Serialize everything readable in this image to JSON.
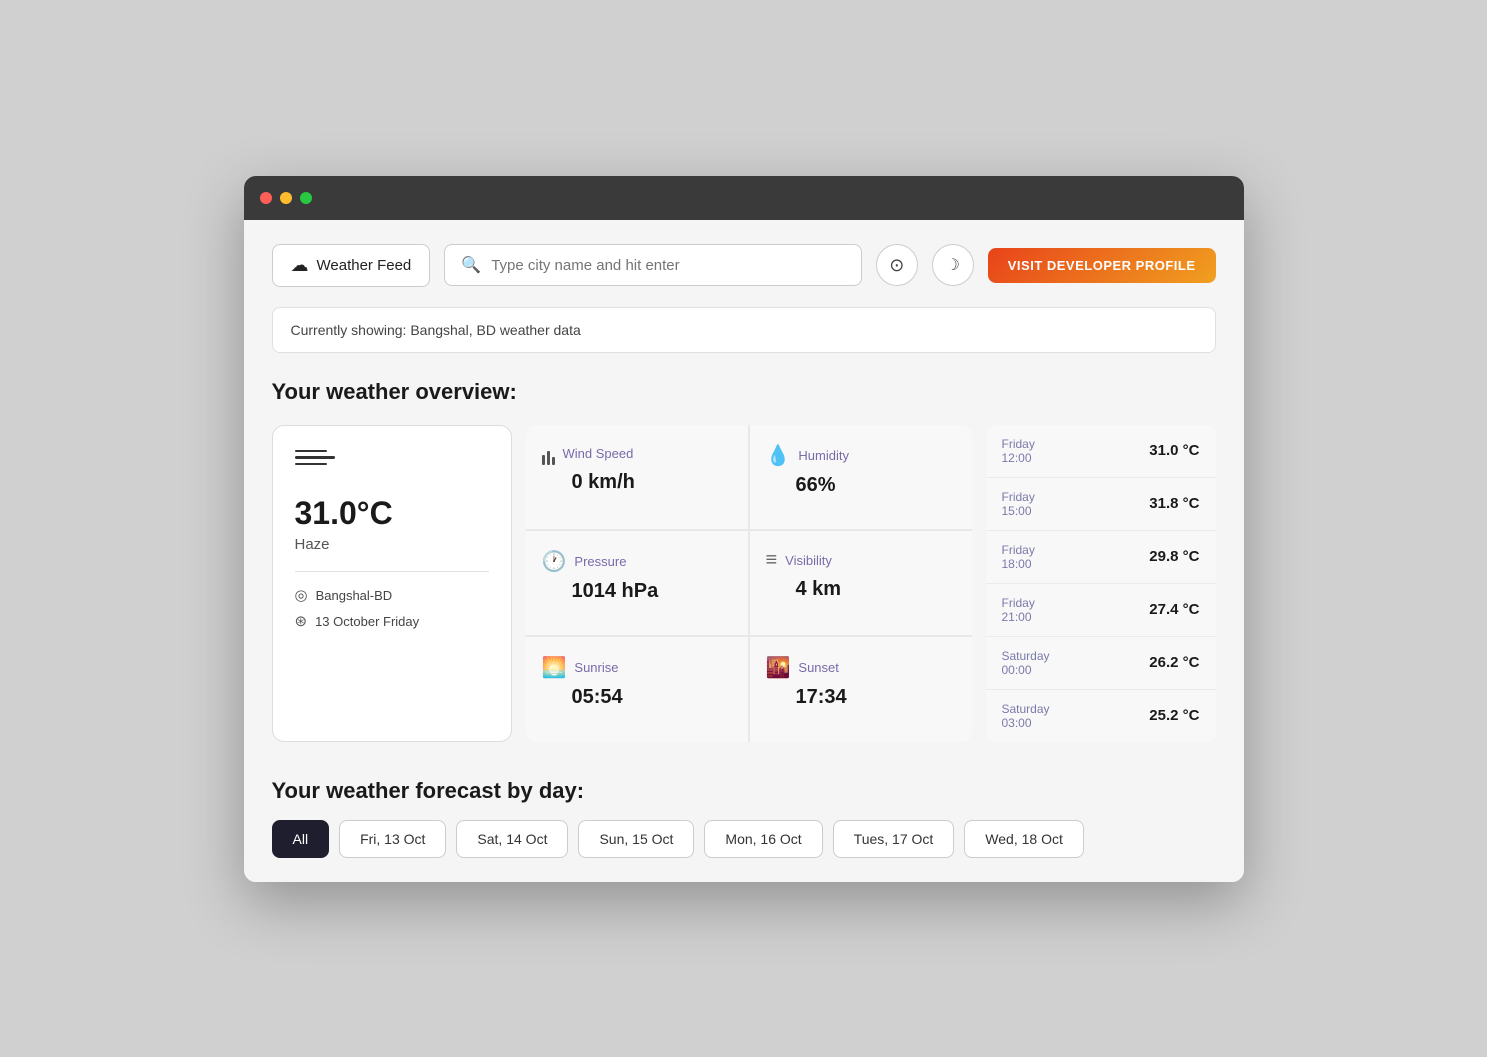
{
  "titlebar": {
    "dots": [
      "red",
      "yellow",
      "green"
    ]
  },
  "navbar": {
    "brand_label": "Weather Feed",
    "search_placeholder": "Type city name and hit enter",
    "compass_icon": "⊙",
    "moon_icon": "☽",
    "visit_btn": "VISIT DEVELOPER PROFILE"
  },
  "status": {
    "text": "Currently showing: Bangshal, BD weather data"
  },
  "overview": {
    "title": "Your weather overview:",
    "main_card": {
      "temperature": "31.0°C",
      "description": "Haze",
      "location": "Bangshal-BD",
      "date": "13 October Friday"
    },
    "stats": [
      {
        "label": "Wind Speed",
        "value": "0 km/h",
        "icon": "wind"
      },
      {
        "label": "Humidity",
        "value": "66%",
        "icon": "drop"
      },
      {
        "label": "Pressure",
        "value": "1014 hPa",
        "icon": "clock"
      },
      {
        "label": "Visibility",
        "value": "4 km",
        "icon": "lines"
      },
      {
        "label": "Sunrise",
        "value": "05:54",
        "icon": "sunrise"
      },
      {
        "label": "Sunset",
        "value": "17:34",
        "icon": "sunset"
      }
    ],
    "forecast": [
      {
        "day": "Friday",
        "time": "12:00",
        "temp": "31.0 °C"
      },
      {
        "day": "Friday",
        "time": "15:00",
        "temp": "31.8 °C"
      },
      {
        "day": "Friday",
        "time": "18:00",
        "temp": "29.8 °C"
      },
      {
        "day": "Friday",
        "time": "21:00",
        "temp": "27.4 °C"
      },
      {
        "day": "Saturday",
        "time": "00:00",
        "temp": "26.2 °C"
      },
      {
        "day": "Saturday",
        "time": "03:00",
        "temp": "25.2 °C"
      }
    ]
  },
  "forecast_section": {
    "title": "Your weather forecast by day:",
    "tabs": [
      {
        "label": "All",
        "active": true
      },
      {
        "label": "Fri, 13 Oct",
        "active": false
      },
      {
        "label": "Sat, 14 Oct",
        "active": false
      },
      {
        "label": "Sun, 15 Oct",
        "active": false
      },
      {
        "label": "Mon, 16 Oct",
        "active": false
      },
      {
        "label": "Tues, 17 Oct",
        "active": false
      },
      {
        "label": "Wed, 18 Oct",
        "active": false
      }
    ]
  }
}
